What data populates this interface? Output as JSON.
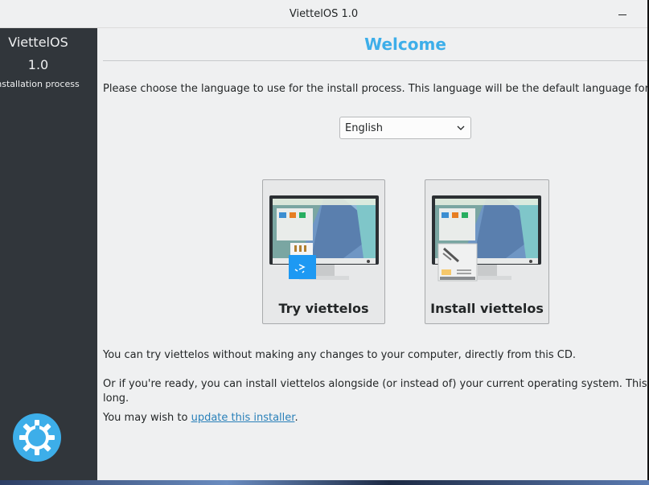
{
  "window": {
    "title": "ViettelOS 1.0"
  },
  "sidebar": {
    "product": "ViettelOS",
    "version": "1.0",
    "step": "Installation process",
    "logo_icon": "kde-gear-logo"
  },
  "main": {
    "heading": "Welcome",
    "prompt": "Please choose the language to use for the install process. This language will be the default language for this computer.",
    "language": {
      "selected": "English"
    },
    "try_button": {
      "label": "Try viettelos",
      "icon": "monitor-usb-icon"
    },
    "install_button": {
      "label": "Install viettelos",
      "icon": "monitor-harddisk-icon"
    },
    "try_text": "You can try viettelos without making any changes to your computer, directly from this CD.",
    "install_text_line1": "Or if you're ready, you can install viettelos alongside (or instead of) your current operating system.  This shouldn't take too",
    "install_text_line2": "long.",
    "update_prefix": "You may wish to ",
    "update_link": "update this installer",
    "update_suffix": "."
  },
  "colors": {
    "accent": "#3daee9",
    "sidebar": "#31363b",
    "link": "#2980b9"
  }
}
